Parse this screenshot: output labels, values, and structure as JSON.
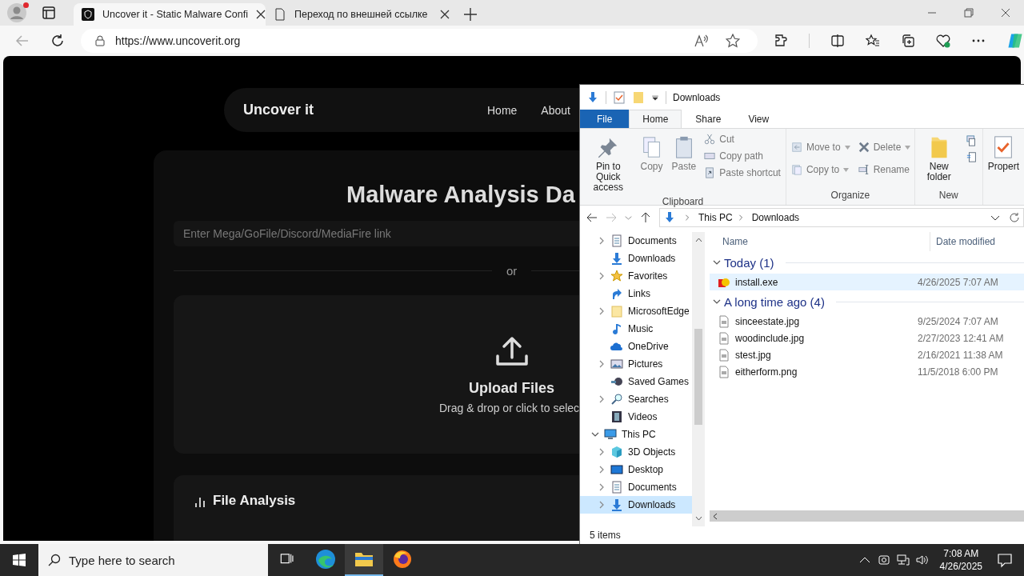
{
  "browser": {
    "profile": {
      "notification": true
    },
    "tabs": [
      {
        "title": "Uncover it - Static Malware Confi",
        "kind": "site",
        "selected": true
      },
      {
        "title": "Переход по внешней ссылке",
        "kind": "page",
        "selected": false
      }
    ],
    "back_disabled": true,
    "address": "https://www.uncoverit.org"
  },
  "website": {
    "brand": "Uncover it",
    "nav": [
      "Home",
      "About"
    ],
    "title": "Malware Analysis Da",
    "link_placeholder": "Enter Mega/GoFile/Discord/MediaFire link",
    "divider": "or",
    "upload": {
      "title": "Upload Files",
      "hint": "Drag & drop or click to selec"
    },
    "section": "File Analysis"
  },
  "explorer": {
    "title": "Downloads",
    "ribbon_tabs": [
      {
        "label": "File",
        "kind": "backstage",
        "selected": false
      },
      {
        "label": "Home",
        "kind": "tab",
        "selected": true
      },
      {
        "label": "Share",
        "kind": "tab",
        "selected": false
      },
      {
        "label": "View",
        "kind": "tab",
        "selected": false
      }
    ],
    "ribbon_groups": [
      {
        "label": "Clipboard",
        "commands": [
          {
            "label": "Pin to Quick access",
            "kind": "pin",
            "disabled": false
          },
          {
            "label": "Copy",
            "kind": "copy",
            "disabled": true
          },
          {
            "label": "Paste",
            "kind": "paste",
            "disabled": true
          },
          {
            "label": "Cut",
            "kind": "cut",
            "disabled": true
          },
          {
            "label": "Copy path",
            "kind": "copypath",
            "disabled": true
          },
          {
            "label": "Paste shortcut",
            "kind": "pasteshortcut",
            "disabled": true
          }
        ]
      },
      {
        "label": "Organize",
        "commands": [
          {
            "label": "Move to",
            "kind": "moveto",
            "disabled": true
          },
          {
            "label": "Copy to",
            "kind": "copyto",
            "disabled": true
          },
          {
            "label": "Delete",
            "kind": "delete",
            "disabled": true
          },
          {
            "label": "Rename",
            "kind": "rename",
            "disabled": true
          }
        ]
      },
      {
        "label": "New",
        "commands": [
          {
            "label": "New folder",
            "kind": "newfolder",
            "disabled": false
          }
        ]
      },
      {
        "commands": [
          {
            "label": "Propert",
            "kind": "properties",
            "disabled": false
          }
        ]
      }
    ],
    "breadcrumb": [
      "This PC",
      "Downloads"
    ],
    "nav": {
      "scrolled": [
        {
          "label": "Documents",
          "kind": "documents",
          "has_children": true,
          "selected": false
        },
        {
          "label": "Downloads",
          "kind": "downloads",
          "has_children": false,
          "selected": false
        },
        {
          "label": "Favorites",
          "kind": "favorites",
          "has_children": true,
          "selected": false
        },
        {
          "label": "Links",
          "kind": "links",
          "has_children": false,
          "selected": false
        },
        {
          "label": "MicrosoftEdge",
          "kind": "folder",
          "has_children": true,
          "selected": false
        },
        {
          "label": "Music",
          "kind": "music",
          "has_children": false,
          "selected": false
        },
        {
          "label": "OneDrive",
          "kind": "onedrive",
          "has_children": false,
          "selected": false
        },
        {
          "label": "Pictures",
          "kind": "pictures",
          "has_children": true,
          "selected": false
        },
        {
          "label": "Saved Games",
          "kind": "games",
          "has_children": false,
          "selected": false
        },
        {
          "label": "Searches",
          "kind": "searches",
          "has_children": true,
          "selected": false
        },
        {
          "label": "Videos",
          "kind": "videos",
          "has_children": false,
          "selected": false
        }
      ],
      "tree": [
        {
          "label": "This PC",
          "kind": "pc",
          "has_children": true,
          "expanded": true,
          "selected": false,
          "children": [
            {
              "label": "3D Objects",
              "kind": "objects",
              "has_children": true,
              "selected": false
            },
            {
              "label": "Desktop",
              "kind": "desktop",
              "has_children": true,
              "selected": false
            },
            {
              "label": "Documents",
              "kind": "documents",
              "has_children": true,
              "selected": false
            },
            {
              "label": "Downloads",
              "kind": "downloads",
              "has_children": true,
              "selected": true
            }
          ]
        }
      ]
    },
    "columns": [
      "Name",
      "Date modified"
    ],
    "groups": [
      {
        "label": "Today (1)",
        "expanded": true,
        "files": [
          {
            "name": "install.exe",
            "date": "4/26/2025 7:07 AM",
            "kind": "exe",
            "selected": true
          }
        ]
      },
      {
        "label": "A long time ago (4)",
        "expanded": true,
        "files": [
          {
            "name": "sinceestate.jpg",
            "date": "9/25/2024 7:07 AM",
            "kind": "image",
            "selected": false
          },
          {
            "name": "woodinclude.jpg",
            "date": "2/27/2023 12:41 AM",
            "kind": "image",
            "selected": false
          },
          {
            "name": "stest.jpg",
            "date": "2/16/2021 11:38 AM",
            "kind": "image",
            "selected": false
          },
          {
            "name": "eitherform.png",
            "date": "11/5/2018 6:00 PM",
            "kind": "image",
            "selected": false
          }
        ]
      }
    ],
    "status": "5 items"
  },
  "taskbar": {
    "search_placeholder": "Type here to search",
    "apps": [
      {
        "kind": "taskview",
        "selected": false
      },
      {
        "kind": "edge",
        "selected": false
      },
      {
        "kind": "explorer",
        "selected": true
      },
      {
        "kind": "firefox",
        "selected": false
      }
    ],
    "time": "7:08 AM",
    "date": "4/26/2025"
  }
}
